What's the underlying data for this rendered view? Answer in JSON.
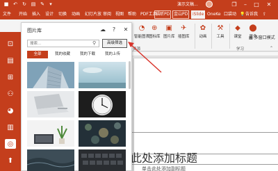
{
  "titlebar": {
    "doc_title": "演示文稿...",
    "window": {
      "restore": "❐",
      "minimize": "–",
      "maximize": "□",
      "close": "✕"
    }
  },
  "tabs": [
    {
      "label": "文件"
    },
    {
      "label": "开始"
    },
    {
      "label": "插入"
    },
    {
      "label": "设计"
    },
    {
      "label": "切换"
    },
    {
      "label": "动画"
    },
    {
      "label": "幻灯片放"
    },
    {
      "label": "审阅"
    },
    {
      "label": "视图"
    },
    {
      "label": "帮助"
    },
    {
      "label": "PDF工具"
    },
    {
      "label": "福昕PD"
    },
    {
      "label": "金山PD"
    },
    {
      "label": "iSlide"
    },
    {
      "label": "OneKe"
    },
    {
      "label": "口袋动"
    },
    {
      "label": "告诉我"
    }
  ],
  "ribbon": {
    "items": [
      {
        "label": "智能图表",
        "icon": "smart-chart-icon"
      },
      {
        "label": "图标库",
        "icon": "icon-library-icon"
      },
      {
        "label": "图片库",
        "icon": "image-library-icon"
      },
      {
        "label": "插图库",
        "icon": "illustration-library-icon"
      },
      {
        "label": "动画",
        "icon": "animation-icon"
      },
      {
        "label": "工具",
        "icon": "tools-icon"
      },
      {
        "label": "课堂",
        "icon": "classroom-icon"
      },
      {
        "label": "更多",
        "icon": "more-icon"
      }
    ],
    "groups": [
      {
        "label": "资源"
      },
      {
        "label": "学习"
      }
    ],
    "multi_window": "多窗口模式"
  },
  "panel": {
    "title": "图片库",
    "search_placeholder": "搜索...",
    "advanced_filter": "高级筛选",
    "filter_tabs": [
      {
        "label": "全部",
        "active": true
      },
      {
        "label": "我的收藏"
      },
      {
        "label": "我的下载"
      },
      {
        "label": "我的上传"
      }
    ],
    "thumbnails": [
      {
        "name": "building"
      },
      {
        "name": "sky"
      },
      {
        "name": "laptop"
      },
      {
        "name": "clock"
      },
      {
        "name": "desk-plant"
      },
      {
        "name": "rain-lights"
      },
      {
        "name": "water"
      },
      {
        "name": "keyboard"
      }
    ]
  },
  "slide": {
    "title_placeholder": "击此处添加标题",
    "subtitle_placeholder": "单击此处添加副标题"
  },
  "colors": {
    "accent": "#c43e1c",
    "ribbon_bg": "#f4f4f4",
    "arrow": "#d9342b"
  }
}
